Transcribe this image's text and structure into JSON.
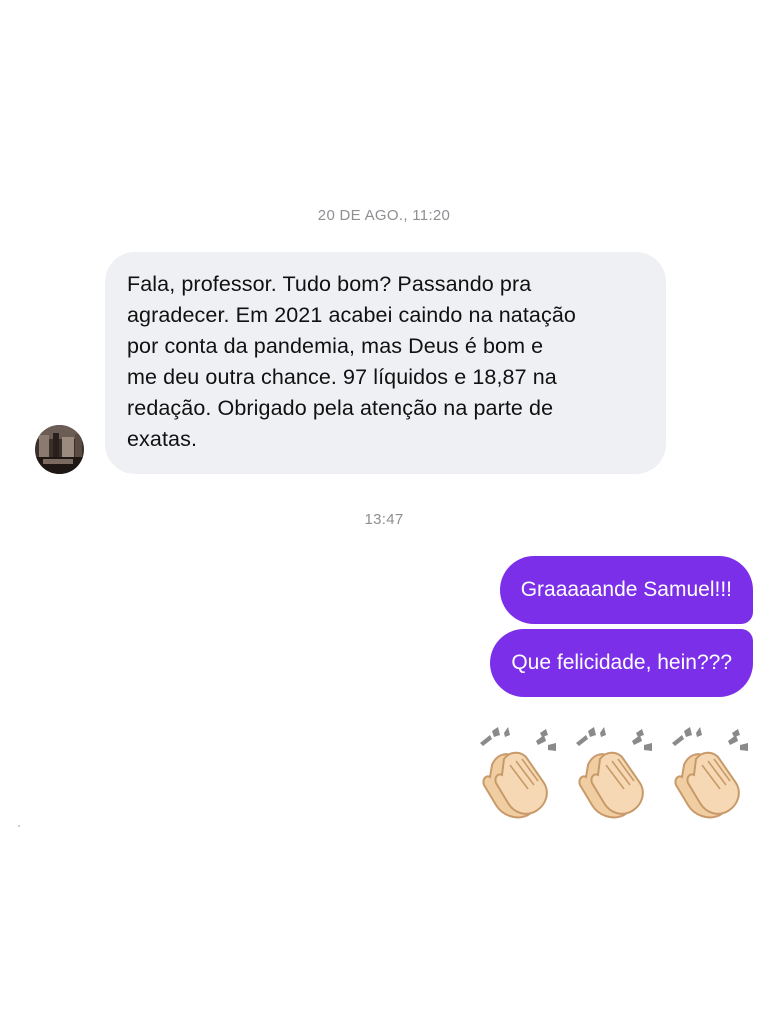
{
  "conversation": {
    "timestamp_1": "20 DE AGO., 11:20",
    "timestamp_2": "13:47",
    "incoming_message": {
      "lines": [
        "Fala, professor. Tudo bom? Passando pra",
        "agradecer. Em 2021 acabei caindo na natação",
        "por conta da pandemia, mas Deus é bom e",
        "me deu outra chance. 97 líquidos e 18,87 na",
        "redação. Obrigado pela atenção na parte de",
        "exatas."
      ]
    },
    "outgoing_messages": [
      "Graaaaande Samuel!!!",
      "Que felicidade, hein???"
    ],
    "emoji_message": {
      "emoji": "clapping-hands",
      "count": 3
    }
  },
  "colors": {
    "outgoing_bubble": "#7c2fe8",
    "incoming_bubble": "#eff0f3",
    "timestamp_text": "#8e8e93"
  }
}
